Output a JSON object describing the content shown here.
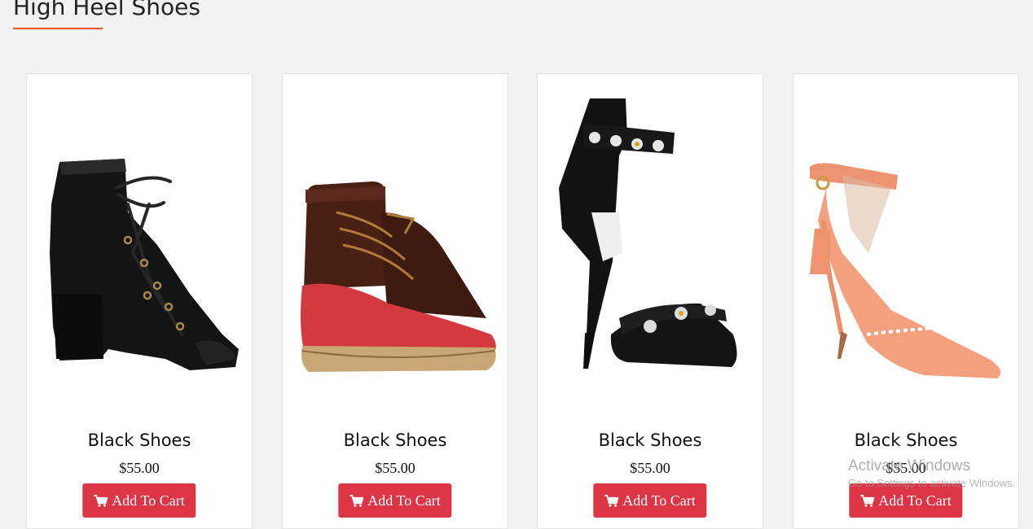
{
  "section": {
    "title": "High Heel Shoes",
    "accent_color": "#e8581c"
  },
  "products": [
    {
      "name": "Black Shoes",
      "price": "$55.00",
      "button_label": "Add To Cart",
      "image": "black-velvet-lace-up-peep-toe-bootie"
    },
    {
      "name": "Black Shoes",
      "price": "$55.00",
      "button_label": "Add To Cart",
      "image": "red-brown-duck-boot"
    },
    {
      "name": "Black Shoes",
      "price": "$55.00",
      "button_label": "Add To Cart",
      "image": "black-jeweled-ankle-strap-sandal"
    },
    {
      "name": "Black Shoes",
      "price": "$55.00",
      "button_label": "Add To Cart",
      "image": "peach-tassel-ankle-strap-pump"
    }
  ],
  "button_color": "#dc3545",
  "watermark": {
    "title": "Activate Windows",
    "subtitle": "Go to Settings to activate Windows."
  }
}
